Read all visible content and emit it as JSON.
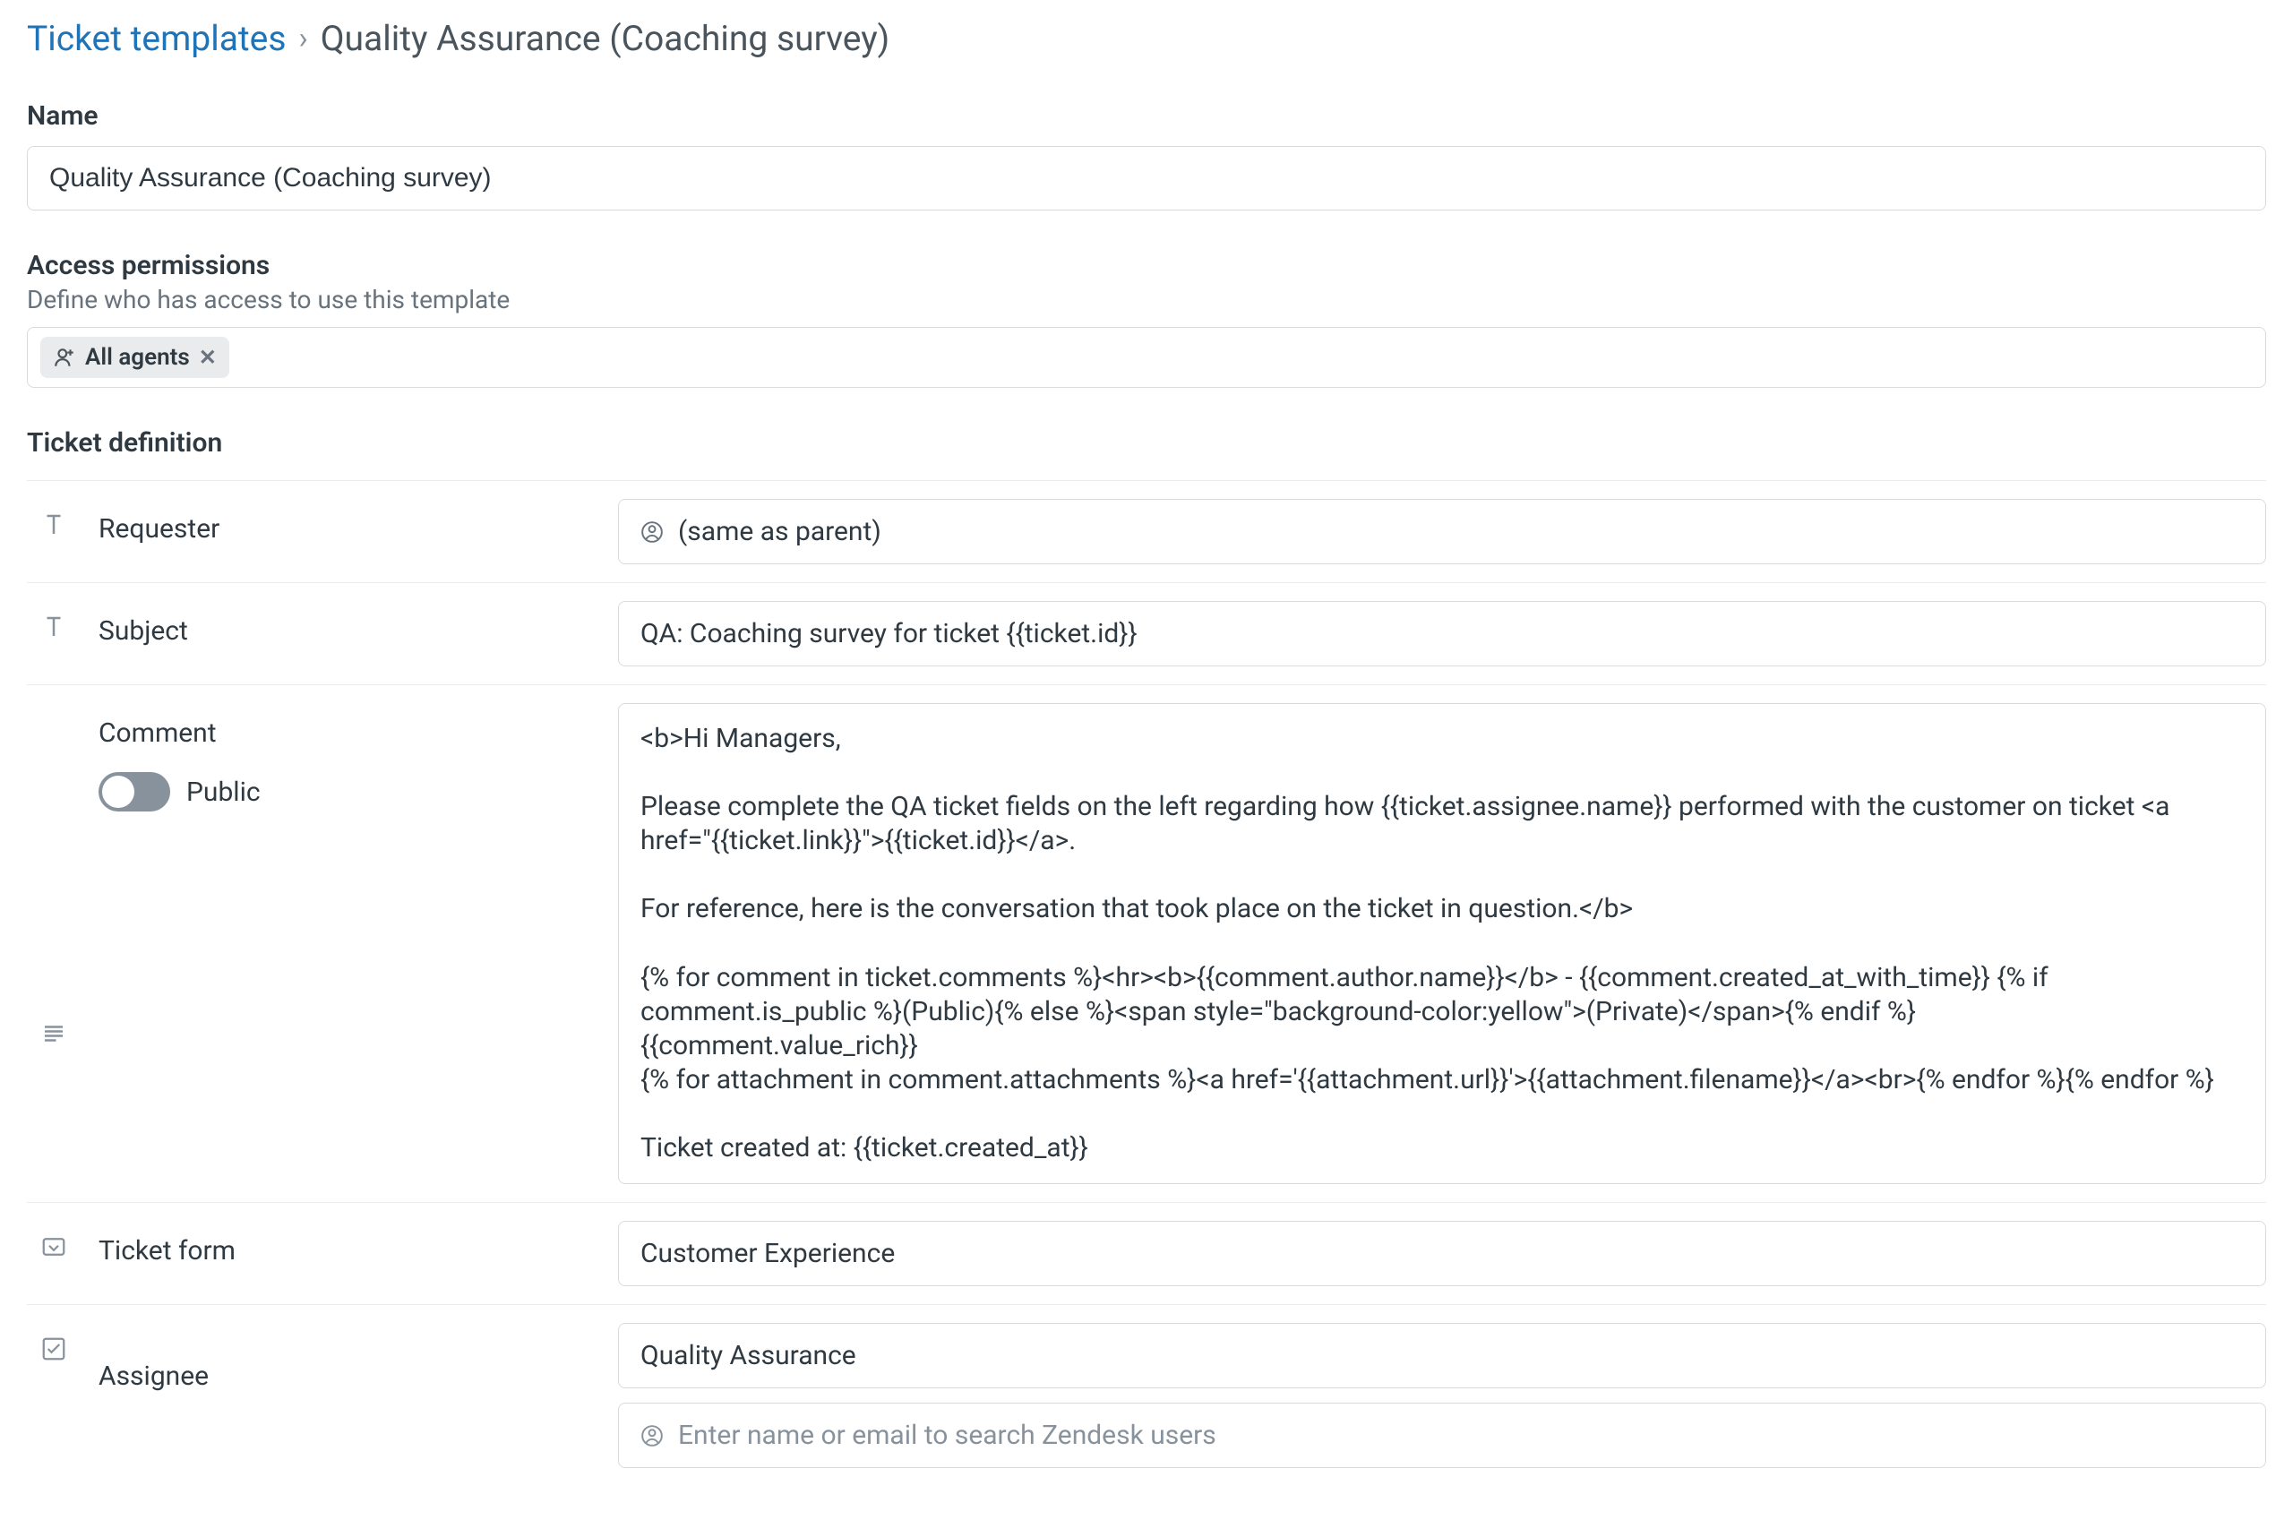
{
  "breadcrumb": {
    "root": "Ticket templates",
    "current": "Quality Assurance (Coaching survey)"
  },
  "name": {
    "label": "Name",
    "value": "Quality Assurance (Coaching survey)"
  },
  "access": {
    "label": "Access permissions",
    "sub": "Define who has access to use this template",
    "chip": "All agents"
  },
  "definition": {
    "label": "Ticket definition",
    "requester": {
      "label": "Requester",
      "value": "(same as parent)"
    },
    "subject": {
      "label": "Subject",
      "value": "QA: Coaching survey for ticket {{ticket.id}}"
    },
    "comment": {
      "label": "Comment",
      "public_label": "Public",
      "body": "<b>Hi Managers,\n\nPlease complete the QA ticket fields on the left regarding how {{ticket.assignee.name}} performed with the customer on ticket <a href=\"{{ticket.link}}\">{{ticket.id}}</a>.\n\nFor reference, here is the conversation that took place on the ticket in question.</b>\n\n{% for comment in ticket.comments %}<hr><b>{{comment.author.name}}</b> - {{comment.created_at_with_time}} {% if comment.is_public %}(Public){% else %}<span style=\"background-color:yellow\">(Private)</span>{% endif %}\n{{comment.value_rich}}\n{% for attachment in comment.attachments %}<a href='{{attachment.url}}'>{{attachment.filename}}</a><br>{% endfor %}{% endfor %}\n\nTicket created at: {{ticket.created_at}}"
    },
    "ticket_form": {
      "label": "Ticket form",
      "value": "Customer Experience"
    },
    "assignee": {
      "label": "Assignee",
      "group_value": "Quality Assurance",
      "user_placeholder": "Enter name or email to search Zendesk users"
    }
  }
}
